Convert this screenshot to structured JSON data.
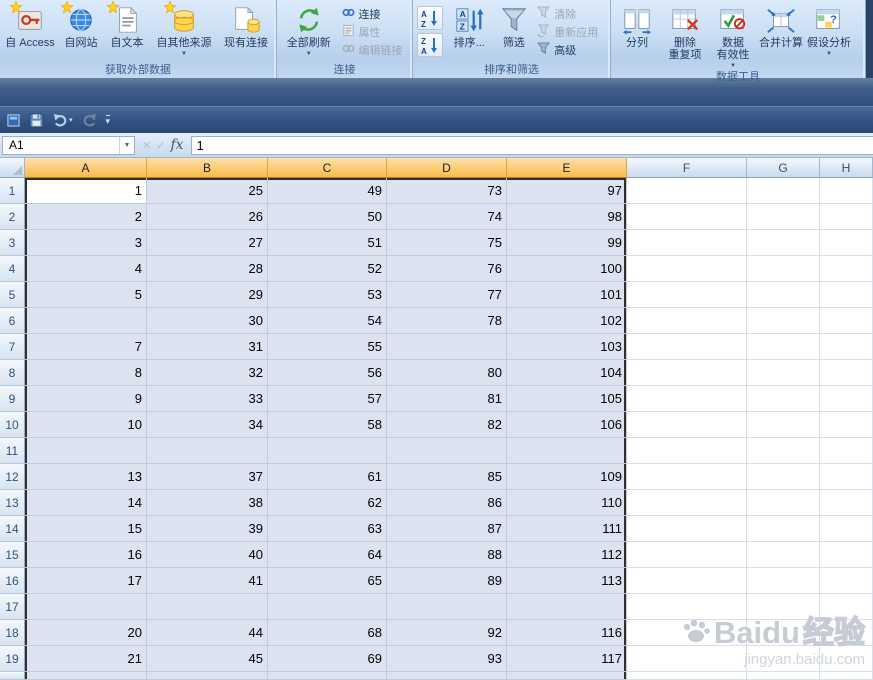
{
  "glyphs": {
    "dropdown": "▼",
    "qat_dropdown": "▾",
    "cancel": "✕",
    "enter": "✓"
  },
  "ribbon": {
    "groups": [
      {
        "label": "获取外部数据",
        "buttons": [
          {
            "label": "自 Access"
          },
          {
            "label": "自网站"
          },
          {
            "label": "自文本"
          },
          {
            "label": "自其他来源",
            "dropdown": true
          },
          {
            "label": "现有连接"
          }
        ]
      },
      {
        "label": "连接",
        "big": {
          "label": "全部刷新",
          "dropdown": true
        },
        "small": [
          {
            "label": "连接"
          },
          {
            "label": "属性"
          },
          {
            "label": "编辑链接"
          }
        ]
      },
      {
        "label": "排序和筛选",
        "sort_button": "排序...",
        "filter_button": "筛选",
        "small": [
          {
            "label": "清除"
          },
          {
            "label": "重新应用"
          },
          {
            "label": "高级"
          }
        ]
      },
      {
        "label": "数据工具",
        "buttons": [
          {
            "line1": "分列"
          },
          {
            "line1": "删除",
            "line2": "重复项"
          },
          {
            "line1": "数据",
            "line2": "有效性",
            "dropdown": true
          },
          {
            "line1": "合并计算"
          },
          {
            "line1": "假设分析",
            "dropdown": true
          }
        ]
      }
    ]
  },
  "formula_bar": {
    "name_box": "A1",
    "fx": "fx",
    "formula": "1"
  },
  "grid": {
    "columns": [
      "A",
      "B",
      "C",
      "D",
      "E",
      "F",
      "G",
      "H"
    ],
    "selected_columns": "A-E",
    "active_cell": "A1",
    "rows": [
      {
        "n": "1",
        "cells": [
          "1",
          "25",
          "49",
          "73",
          "97"
        ]
      },
      {
        "n": "2",
        "cells": [
          "2",
          "26",
          "50",
          "74",
          "98"
        ]
      },
      {
        "n": "3",
        "cells": [
          "3",
          "27",
          "51",
          "75",
          "99"
        ]
      },
      {
        "n": "4",
        "cells": [
          "4",
          "28",
          "52",
          "76",
          "100"
        ]
      },
      {
        "n": "5",
        "cells": [
          "5",
          "29",
          "53",
          "77",
          "101"
        ]
      },
      {
        "n": "6",
        "cells": [
          "",
          "30",
          "54",
          "78",
          "102"
        ]
      },
      {
        "n": "7",
        "cells": [
          "7",
          "31",
          "55",
          "",
          "103"
        ]
      },
      {
        "n": "8",
        "cells": [
          "8",
          "32",
          "56",
          "80",
          "104"
        ]
      },
      {
        "n": "9",
        "cells": [
          "9",
          "33",
          "57",
          "81",
          "105"
        ]
      },
      {
        "n": "10",
        "cells": [
          "10",
          "34",
          "58",
          "82",
          "106"
        ]
      },
      {
        "n": "11",
        "cells": [
          "",
          "",
          "",
          "",
          ""
        ]
      },
      {
        "n": "12",
        "cells": [
          "13",
          "37",
          "61",
          "85",
          "109"
        ]
      },
      {
        "n": "13",
        "cells": [
          "14",
          "38",
          "62",
          "86",
          "110"
        ]
      },
      {
        "n": "14",
        "cells": [
          "15",
          "39",
          "63",
          "87",
          "111"
        ]
      },
      {
        "n": "15",
        "cells": [
          "16",
          "40",
          "64",
          "88",
          "112"
        ]
      },
      {
        "n": "16",
        "cells": [
          "17",
          "41",
          "65",
          "89",
          "113"
        ]
      },
      {
        "n": "17",
        "cells": [
          "",
          "",
          "",
          "",
          ""
        ]
      },
      {
        "n": "18",
        "cells": [
          "20",
          "44",
          "68",
          "92",
          "116"
        ]
      },
      {
        "n": "19",
        "cells": [
          "21",
          "45",
          "69",
          "93",
          "117"
        ]
      }
    ]
  },
  "watermark": {
    "brand": "Baidu",
    "brand_suffix": "经验",
    "site": "jingyan.baidu.com"
  }
}
